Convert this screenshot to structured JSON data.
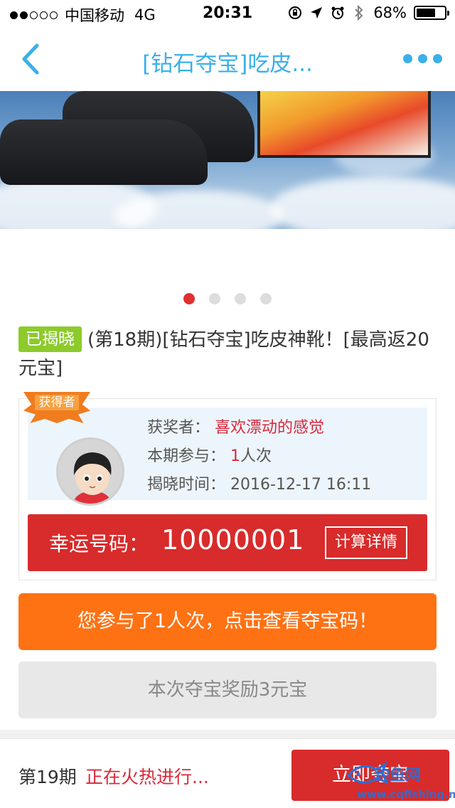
{
  "status_bar": {
    "carrier": "中国移动",
    "network": "4G",
    "time": "20:31",
    "battery": "68%",
    "battery_level": 0.68
  },
  "nav": {
    "title": "[钻石夺宝]吃皮...",
    "back_icon": "chevron-left-icon",
    "more_icon": "more-dots-icon"
  },
  "carousel": {
    "dots": 4,
    "active_index": 0
  },
  "product": {
    "badge": "已揭晓",
    "title": "(第18期)[钻石夺宝]吃皮神靴！[最高返20元宝]"
  },
  "winner": {
    "ribbon_label": "获得者",
    "winner_label": "获奖者：",
    "winner_name": "喜欢漂动的感觉",
    "participation_label": "本期参与：",
    "participation_count": "1",
    "participation_unit": "人次",
    "reveal_label": "揭晓时间：",
    "reveal_time": "2016-12-17 16:11"
  },
  "lucky": {
    "label": "幸运号码：",
    "number": "10000001",
    "calc_button": "计算详情"
  },
  "actions": {
    "view_codes": "您参与了1人次，点击查看夺宝码！",
    "reward": "本次夺宝奖励3元宝"
  },
  "bottom": {
    "period": "第19期",
    "status": "正在火热进行...",
    "join_button": "立即夺宝"
  },
  "watermark": {
    "name": "钓鱼网",
    "url": "www.cqfishing.net"
  },
  "colors": {
    "accent_blue": "#3bb0e8",
    "red": "#d82b2b",
    "orange": "#ff7214",
    "green_badge": "#8ccb2b"
  }
}
